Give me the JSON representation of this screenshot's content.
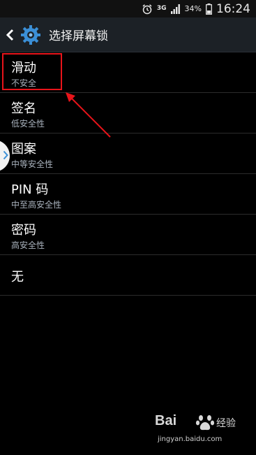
{
  "status_bar": {
    "network": "3G",
    "battery": "34%",
    "time": "16:24",
    "icons": [
      "alarm-icon",
      "network-3g-icon",
      "signal-icon",
      "battery-icon"
    ]
  },
  "action_bar": {
    "title": "选择屏幕锁",
    "icons": [
      "back-icon",
      "settings-gear-icon"
    ]
  },
  "lock_options": [
    {
      "title": "滑动",
      "subtitle": "不安全"
    },
    {
      "title": "签名",
      "subtitle": "低安全性"
    },
    {
      "title": "图案",
      "subtitle": "中等安全性"
    },
    {
      "title": "PIN 码",
      "subtitle": "中至高安全性"
    },
    {
      "title": "密码",
      "subtitle": "高安全性"
    },
    {
      "title": "无",
      "subtitle": ""
    }
  ],
  "annotation": {
    "highlight_color": "#e8141a"
  },
  "watermark": {
    "logo_text": "Bai",
    "brand_cn": "经验",
    "url": "jingyan.baidu.com"
  },
  "colors": {
    "action_bar_bg": "#1c2126",
    "background": "#000000",
    "subtitle": "#a9b2bd",
    "gear_blue": "#3b8fd6"
  }
}
